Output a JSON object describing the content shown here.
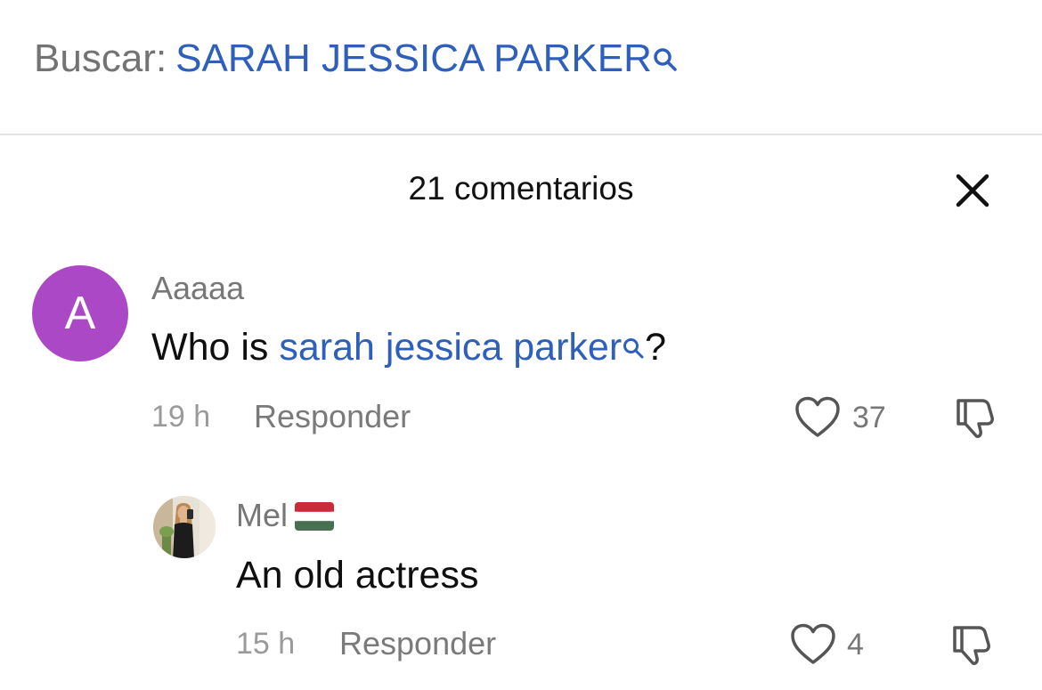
{
  "search": {
    "label": "Buscar:",
    "query": "SARAH JESSICA PARKER"
  },
  "header": {
    "title": "21 comentarios"
  },
  "comments": [
    {
      "avatar_letter": "A",
      "avatar_color": "#ab48c5",
      "username": "Aaaaa",
      "text_prefix": "Who is ",
      "text_link": "sarah jessica parker",
      "text_suffix": "?",
      "time": "19 h",
      "reply_label": "Responder",
      "likes": "37"
    },
    {
      "avatar_icon": "profile-photo",
      "username": "Mel",
      "flag_icon": "hungary-flag-icon",
      "text": "An old actress",
      "time": "15 h",
      "reply_label": "Responder",
      "likes": "4"
    }
  ],
  "colors": {
    "link": "#2e5fbb",
    "muted": "#777777"
  }
}
